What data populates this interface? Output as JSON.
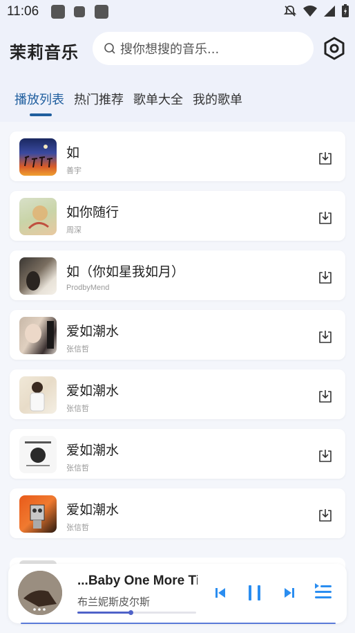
{
  "status_bar": {
    "time": "11:06"
  },
  "header": {
    "app_title": "茉莉音乐",
    "search_placeholder": "搜你想搜的音乐...",
    "tabs": [
      {
        "label": "播放列表",
        "active": true
      },
      {
        "label": "热门推荐",
        "active": false
      },
      {
        "label": "歌单大全",
        "active": false
      },
      {
        "label": "我的歌单",
        "active": false
      }
    ]
  },
  "songs": [
    {
      "title": "如",
      "artist": "善宇"
    },
    {
      "title": "如你随行",
      "artist": "周深"
    },
    {
      "title": "如（你如星我如月）",
      "artist": "ProdbyMend"
    },
    {
      "title": "爱如潮水",
      "artist": "张信哲"
    },
    {
      "title": "爱如潮水",
      "artist": "张信哲"
    },
    {
      "title": "爱如潮水",
      "artist": "张信哲"
    },
    {
      "title": "爱如潮水",
      "artist": "张信哲"
    }
  ],
  "player": {
    "title": "...Baby One More Time",
    "artist": "布兰妮斯皮尔斯",
    "progress": 0.45
  },
  "colors": {
    "accent": "#1f5e9e",
    "control": "#2a8df0",
    "progress": "#4f62c8"
  }
}
